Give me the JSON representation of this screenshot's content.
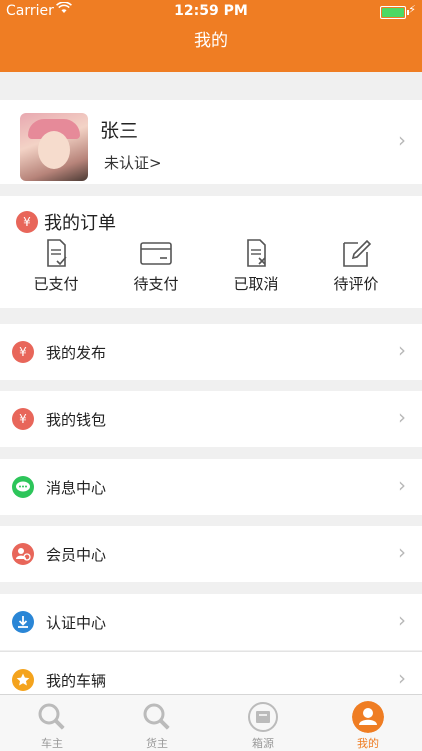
{
  "status_bar": {
    "carrier": "Carrier",
    "time": "12:59 PM"
  },
  "header": {
    "title": "我的"
  },
  "profile": {
    "name": "张三",
    "verify_status": "未认证>"
  },
  "orders": {
    "title": "我的订单",
    "items": [
      {
        "label": "已支付",
        "icon": "paid-icon"
      },
      {
        "label": "待支付",
        "icon": "card-icon"
      },
      {
        "label": "已取消",
        "icon": "cancelled-doc-icon"
      },
      {
        "label": "待评价",
        "icon": "edit-icon"
      }
    ]
  },
  "menu": [
    {
      "label": "我的发布",
      "icon": "yen-icon",
      "color": "#e8665a"
    },
    {
      "label": "我的钱包",
      "icon": "yen-icon",
      "color": "#e8665a"
    },
    {
      "label": "消息中心",
      "icon": "chat-icon",
      "color": "#2dc55a"
    },
    {
      "label": "会员中心",
      "icon": "member-icon",
      "color": "#e8665a"
    },
    {
      "label": "认证中心",
      "icon": "download-icon",
      "color": "#2a86d6"
    },
    {
      "label": "我的车辆",
      "icon": "star-icon",
      "color": "#f4a31d"
    }
  ],
  "tabbar": [
    {
      "label": "车主",
      "icon": "search-icon"
    },
    {
      "label": "货主",
      "icon": "search-icon"
    },
    {
      "label": "箱源",
      "icon": "box-icon"
    },
    {
      "label": "我的",
      "icon": "user-icon",
      "active": true
    }
  ],
  "colors": {
    "accent": "#ef7d23"
  }
}
